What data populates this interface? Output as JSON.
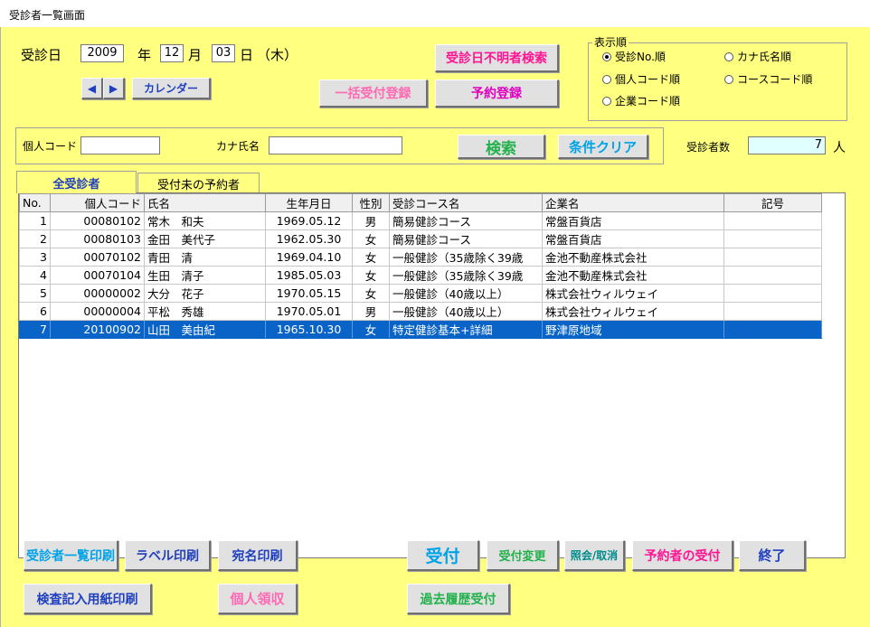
{
  "window": {
    "title": "受診者一覧画面"
  },
  "date": {
    "label": "受診日",
    "year": "2009",
    "year_unit": "年",
    "month": "12",
    "month_unit": "月",
    "day": "03",
    "day_unit": "日",
    "weekday": "（木）",
    "calendar_button": "カレンダー"
  },
  "buttons": {
    "unknown_date_search": "受診日不明者検索",
    "bulk_reception": "一括受付登録",
    "reservation": "予約登録",
    "search": "検索",
    "clear": "条件クリア",
    "print_list": "受診者一覧印刷",
    "print_label": "ラベル印刷",
    "print_address": "宛名印刷",
    "reception": "受付",
    "change_reception": "受付変更",
    "inquiry_cancel": "照会/取消",
    "reserved_reception": "予約者の受付",
    "exit": "終了",
    "print_exam_form": "検査記入用紙印刷",
    "personal_receipt": "個人領収",
    "history_reception": "過去履歴受付"
  },
  "sort": {
    "legend": "表示順",
    "options": [
      "受診No.順",
      "カナ氏名順",
      "個人コード順",
      "コースコード順",
      "企業コード順"
    ],
    "selected": "受診No.順"
  },
  "filter": {
    "code_label": "個人コード",
    "code_value": "",
    "kana_label": "カナ氏名",
    "kana_value": ""
  },
  "count": {
    "label": "受診者数",
    "value": "7",
    "unit": "人"
  },
  "tabs": [
    "全受診者",
    "受付未の予約者"
  ],
  "table": {
    "headers": [
      "No.",
      "個人コード",
      "氏名",
      "生年月日",
      "性別",
      "受診コース名",
      "企業名",
      "記号"
    ],
    "rows": [
      [
        "1",
        "00080102",
        "常木　和夫",
        "1969.05.12",
        "男",
        "簡易健診コース",
        "常盤百貨店",
        ""
      ],
      [
        "2",
        "00080103",
        "金田　美代子",
        "1962.05.30",
        "女",
        "簡易健診コース",
        "常盤百貨店",
        ""
      ],
      [
        "3",
        "00070102",
        "青田　清",
        "1969.04.10",
        "女",
        "一般健診（35歳除く39歳",
        "金池不動産株式会社",
        ""
      ],
      [
        "4",
        "00070104",
        "生田　清子",
        "1985.05.03",
        "女",
        "一般健診（35歳除く39歳",
        "金池不動産株式会社",
        ""
      ],
      [
        "5",
        "00000002",
        "大分　花子",
        "1970.05.15",
        "女",
        "一般健診（40歳以上）",
        "株式会社ウィルウェイ",
        ""
      ],
      [
        "6",
        "00000004",
        "平松　秀雄",
        "1970.05.01",
        "男",
        "一般健診（40歳以上）",
        "株式会社ウィルウェイ",
        ""
      ],
      [
        "7",
        "20100902",
        "山田　美由紀",
        "1965.10.30",
        "女",
        "特定健診基本+詳細",
        "野津原地域",
        ""
      ]
    ],
    "selected_row": 7
  },
  "colors": {
    "background": "#ffff80",
    "selection": "#0a64c8",
    "pink": "#ff1493",
    "green": "#22b14c",
    "blue": "#1f3fbf",
    "cyan": "#00a2e8",
    "teal": "#008b8b"
  }
}
